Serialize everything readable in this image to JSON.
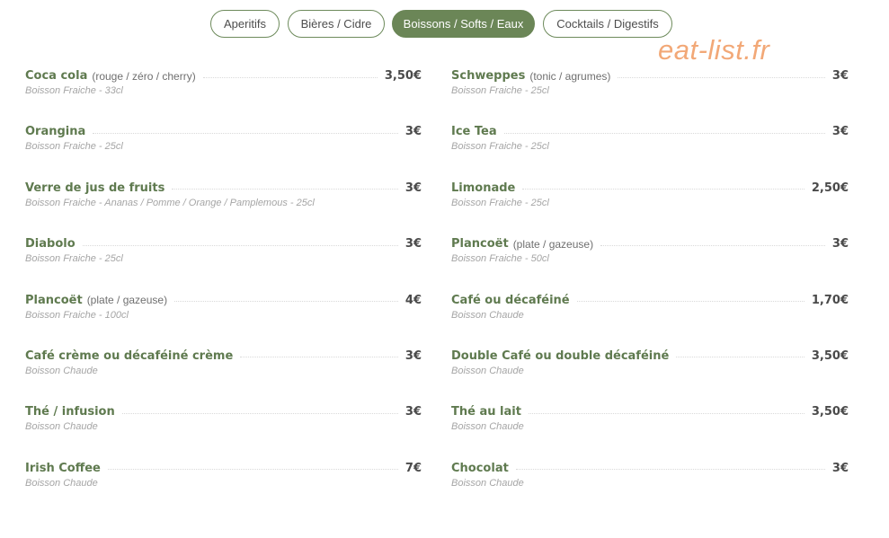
{
  "tabs": [
    {
      "label": "Aperitifs",
      "active": false
    },
    {
      "label": "Bières / Cidre",
      "active": false
    },
    {
      "label": "Boissons / Softs / Eaux",
      "active": true
    },
    {
      "label": "Cocktails / Digestifs",
      "active": false
    }
  ],
  "watermark": "eat-list.fr",
  "colors": {
    "accent": "#6b8657",
    "item_name": "#5f7a4f",
    "watermark": "#f2a877"
  },
  "menu": {
    "left": [
      {
        "name": "Coca cola",
        "note": "(rouge / zéro / cherry)",
        "price": "3,50€",
        "desc": "Boisson Fraiche - 33cl"
      },
      {
        "name": "Orangina",
        "note": "",
        "price": "3€",
        "desc": "Boisson Fraiche - 25cl"
      },
      {
        "name": "Verre de jus de fruits",
        "note": "",
        "price": "3€",
        "desc": "Boisson Fraiche - Ananas / Pomme / Orange / Pamplemous - 25cl"
      },
      {
        "name": "Diabolo",
        "note": "",
        "price": "3€",
        "desc": "Boisson Fraiche - 25cl"
      },
      {
        "name": "Plancoët",
        "note": "(plate / gazeuse)",
        "price": "4€",
        "desc": "Boisson Fraiche - 100cl"
      },
      {
        "name": "Café crème ou décaféiné crème",
        "note": "",
        "price": "3€",
        "desc": "Boisson Chaude"
      },
      {
        "name": "Thé / infusion",
        "note": "",
        "price": "3€",
        "desc": "Boisson Chaude"
      },
      {
        "name": "Irish Coffee",
        "note": "",
        "price": "7€",
        "desc": "Boisson Chaude"
      }
    ],
    "right": [
      {
        "name": "Schweppes",
        "note": "(tonic / agrumes)",
        "price": "3€",
        "desc": "Boisson Fraiche - 25cl"
      },
      {
        "name": "Ice Tea",
        "note": "",
        "price": "3€",
        "desc": "Boisson Fraiche - 25cl"
      },
      {
        "name": "Limonade",
        "note": "",
        "price": "2,50€",
        "desc": "Boisson Fraiche - 25cl"
      },
      {
        "name": "Plancoët",
        "note": "(plate / gazeuse)",
        "price": "3€",
        "desc": "Boisson Fraiche - 50cl"
      },
      {
        "name": "Café ou décaféiné",
        "note": "",
        "price": "1,70€",
        "desc": "Boisson Chaude"
      },
      {
        "name": "Double Café ou double décaféiné",
        "note": "",
        "price": "3,50€",
        "desc": "Boisson Chaude"
      },
      {
        "name": "Thé au lait",
        "note": "",
        "price": "3,50€",
        "desc": "Boisson Chaude"
      },
      {
        "name": "Chocolat",
        "note": "",
        "price": "3€",
        "desc": "Boisson Chaude"
      }
    ]
  }
}
